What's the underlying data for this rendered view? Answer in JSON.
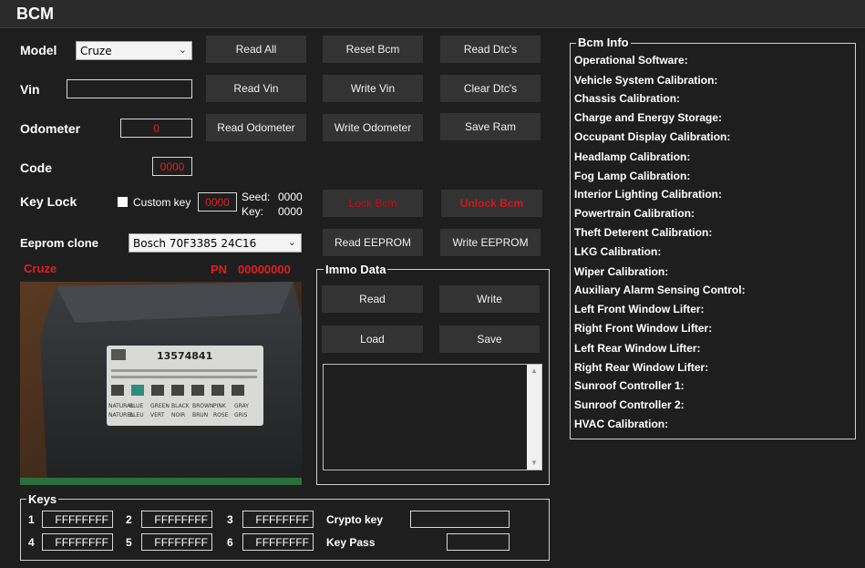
{
  "window": {
    "title": "BCM"
  },
  "model": {
    "label": "Model",
    "selected": "Cruze"
  },
  "vin": {
    "label": "Vin",
    "value": ""
  },
  "odometer": {
    "label": "Odometer",
    "value": "0"
  },
  "code": {
    "label": "Code",
    "value": "0000"
  },
  "keylock": {
    "label": "Key Lock",
    "custom_key_label": "Custom key",
    "value": "0000",
    "seed_label": "Seed:",
    "seed_value": "0000",
    "key_label": "Key:",
    "key_value": "0000"
  },
  "eeprom": {
    "label": "Eeprom clone",
    "selected": "Bosch 70F3385 24C16"
  },
  "buttons": {
    "read_all": "Read All",
    "reset_bcm": "Reset Bcm",
    "read_dtcs": "Read Dtc's",
    "read_vin": "Read Vin",
    "write_vin": "Write Vin",
    "clear_dtcs": "Clear Dtc's",
    "read_odometer": "Read Odometer",
    "write_odometer": "Write Odometer",
    "save_ram": "Save Ram",
    "lock_bcm": "Lock Bcm",
    "unlock_bcm": "Unlock Bcm",
    "read_eeprom": "Read EEPROM",
    "write_eeprom": "Write EEPROM"
  },
  "module": {
    "name": "Cruze",
    "pn_label": "PN",
    "pn_value": "00000000"
  },
  "photo": {
    "part_number": "13574841",
    "color_top": [
      "NATURAL",
      "BLUE",
      "GREEN",
      "BLACK",
      "BROWN",
      "PINK",
      "GRAY"
    ],
    "color_bottom": [
      "NATUREL",
      "BLEU",
      "VERT",
      "NOIR",
      "BRUN",
      "ROSE",
      "GRIS"
    ]
  },
  "immo": {
    "title": "Immo Data",
    "read": "Read",
    "write": "Write",
    "load": "Load",
    "save": "Save",
    "text": ""
  },
  "bcm_info": {
    "title": "Bcm Info",
    "items": [
      "Operational Software:",
      "Vehicle System Calibration:",
      "Chassis Calibration:",
      "Charge and Energy Storage:",
      "Occupant Display Calibration:",
      "Headlamp Calibration:",
      "Fog Lamp Calibration:",
      "Interior Lighting Calibration:",
      "Powertrain Calibration:",
      "Theft Deterent Calibration:",
      "LKG Calibration:",
      "Wiper Calibration:",
      "Auxiliary Alarm Sensing Control:",
      "Left Front Window Lifter:",
      "Right Front Window Lifter:",
      "Left Rear Window Lifter:",
      "Right Rear Window Lifter:",
      "Sunroof Controller 1:",
      "Sunroof Controller 2:",
      "HVAC Calibration:"
    ]
  },
  "keys": {
    "title": "Keys",
    "labels": [
      "1",
      "2",
      "3",
      "4",
      "5",
      "6"
    ],
    "values": [
      "FFFFFFFF",
      "FFFFFFFF",
      "FFFFFFFF",
      "FFFFFFFF",
      "FFFFFFFF",
      "FFFFFFFF"
    ],
    "crypto_label": "Crypto key",
    "crypto_value": "",
    "keypass_label": "Key Pass",
    "keypass_value": ""
  },
  "colors": {
    "accent_red": "#e02020",
    "panel": "#1e1e1e",
    "button": "#333333"
  }
}
